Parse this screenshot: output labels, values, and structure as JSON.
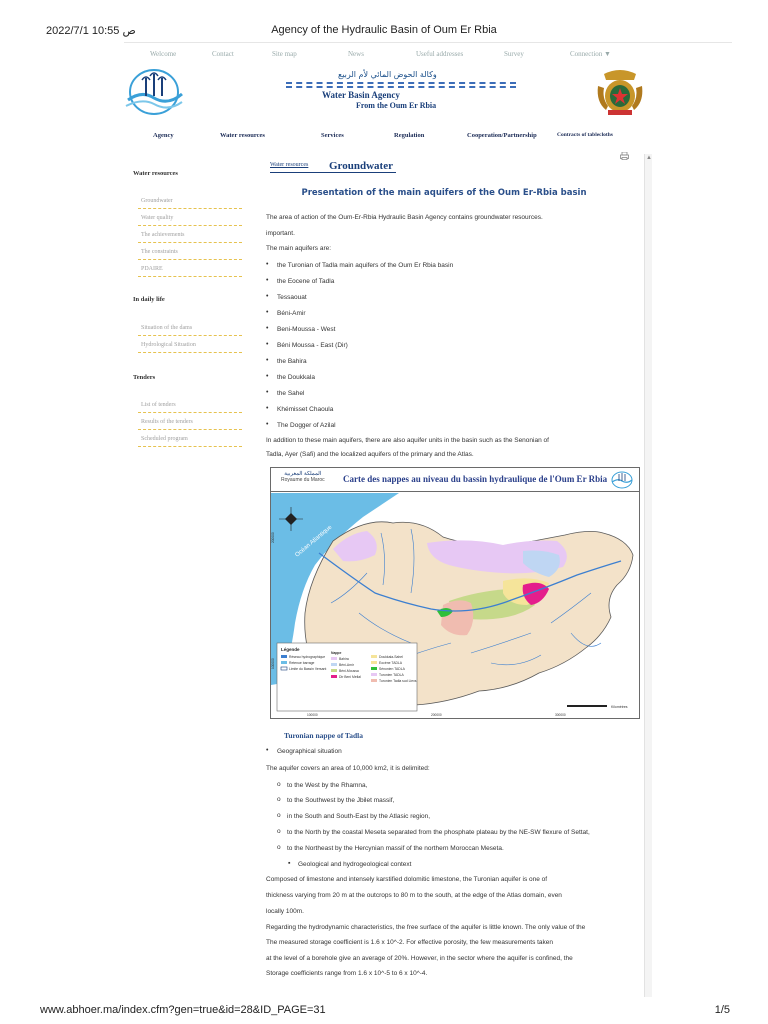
{
  "print": {
    "datetime": "2022/7/1 10:55 ص",
    "title": "Agency of the Hydraulic Basin of Oum Er Rbia",
    "url": "www.abhoer.ma/index.cfm?gen=true&id=28&ID_PAGE=31",
    "page": "1/5"
  },
  "topnav": [
    "Welcome",
    "Contact",
    "Site map",
    "News",
    "Useful addresses",
    "Survey",
    "Connection ▼"
  ],
  "header": {
    "arabic": "وكالة الحوض المائي لأم الربيع",
    "agency_name": "Water Basin Agency",
    "agency_sub": "From the Oum Er Rbia"
  },
  "mainnav": [
    "Agency",
    "Water resources",
    "Services",
    "Regulation",
    "Cooperation/Partnership",
    "Contracts of tablecloths"
  ],
  "sidebar": {
    "section1": "Water resources",
    "items1": [
      "Groundwater",
      "Water quality",
      "The achievements",
      "The constraints",
      "PDAIRE"
    ],
    "section2": "In daily life",
    "items2": [
      "Situation of the dams",
      "Hydrological Situation"
    ],
    "section3": "Tenders",
    "items3": [
      "List of tenders",
      "Results of the tenders",
      "Scheduled program"
    ]
  },
  "content": {
    "breadcrumb": "Water resources",
    "page_title": "Groundwater",
    "heading": "Presentation of the main aquifers of the Oum Er-Rbia basin",
    "intro1": "The area of action of the Oum-Er-Rbia Hydraulic Basin Agency contains groundwater resources.",
    "intro2": "important.",
    "intro3": "The main aquifers are:",
    "aquifers": [
      "the Turonian of Tadla main aquifers of the Oum Er Rbia basin",
      "the Eocene of Tadla",
      "Tessaouat",
      "Béni-Amir",
      "Beni-Moussa - West",
      "Béni Moussa - East (Dir)",
      "the Bahira",
      "the Doukkala",
      "the Sahel",
      "Khémisset Chaoula",
      "The Dogger of Azilal"
    ],
    "addition1": "In addition to these main aquifers, there are also aquifer units in the basin such as the Senonian of",
    "addition2": "Tadla, Ayer (Safi) and the localized aquifers of the primary and the Atlas.",
    "map_title": "Carte des nappes au niveau du bassin hydraulique de l'Oum Er Rbia",
    "map_kingdom_ar": "المملكة المغربية",
    "map_kingdom": "Royaume du Maroc",
    "map_ocean": "Océan Atlantique",
    "map_legend_title": "Légende",
    "map_legend": [
      "Réseau hydrographique",
      "Retenue barrage",
      "Limite du Bassin Versant",
      "Nappe",
      "Bahira",
      "Béni-Amir",
      "Béni-Moussa",
      "Dir Beni Mellal",
      "Doukkala-Sahel",
      "Eocène TADLA",
      "Sénonien TADLA",
      "Turonien TADLA",
      "Turonien Tadla sud Liexs"
    ],
    "map_scale": "Kilomètres",
    "map_axis": [
      "100000",
      "200000",
      "300000",
      "100000",
      "200000"
    ],
    "sub_heading": "Turonian nappe of Tadla",
    "geo_bullet": "Geographical situation",
    "area_text": "The aquifer covers an area of 10,000 km2, it is delimited:",
    "limits": [
      "to the West by the Rhamna,",
      "to the Southwest by the Jbilet massif,",
      "in the South and South-East by the Atlasic region,",
      "to the North by the coastal Meseta separated from the phosphate plateau by the NE-SW flexure of Settat,",
      "to the Northeast by the Hercynian massif of the northern Moroccan Meseta."
    ],
    "geo_context": "Geological and hydrogeological context",
    "composed1": "Composed of limestone and intensely karstified dolomitic limestone, the Turonian aquifer is one of",
    "composed2": "thickness varying from 20 m at the outcrops to 80 m to the south, at the edge of the Atlas domain, even",
    "composed3": "locally 100m.",
    "regarding1": "Regarding the hydrodynamic characteristics, the free surface of the aquifer is little known. The only value of the",
    "regarding2": "The measured storage coefficient is 1.6 x 10^-2. For effective porosity, the few measurements taken",
    "regarding3": "at the level of a borehole give an average of 20%. However, in the sector where the aquifer is confined, the",
    "regarding4": "Storage coefficients range from 1.6 x 10^-5 to 6 x 10^-4."
  },
  "colors": {
    "brand_blue": "#1a3f7a",
    "accent_yellow": "#e6c24f",
    "sea": "#6bbde6",
    "land": "#f3e2c9"
  }
}
